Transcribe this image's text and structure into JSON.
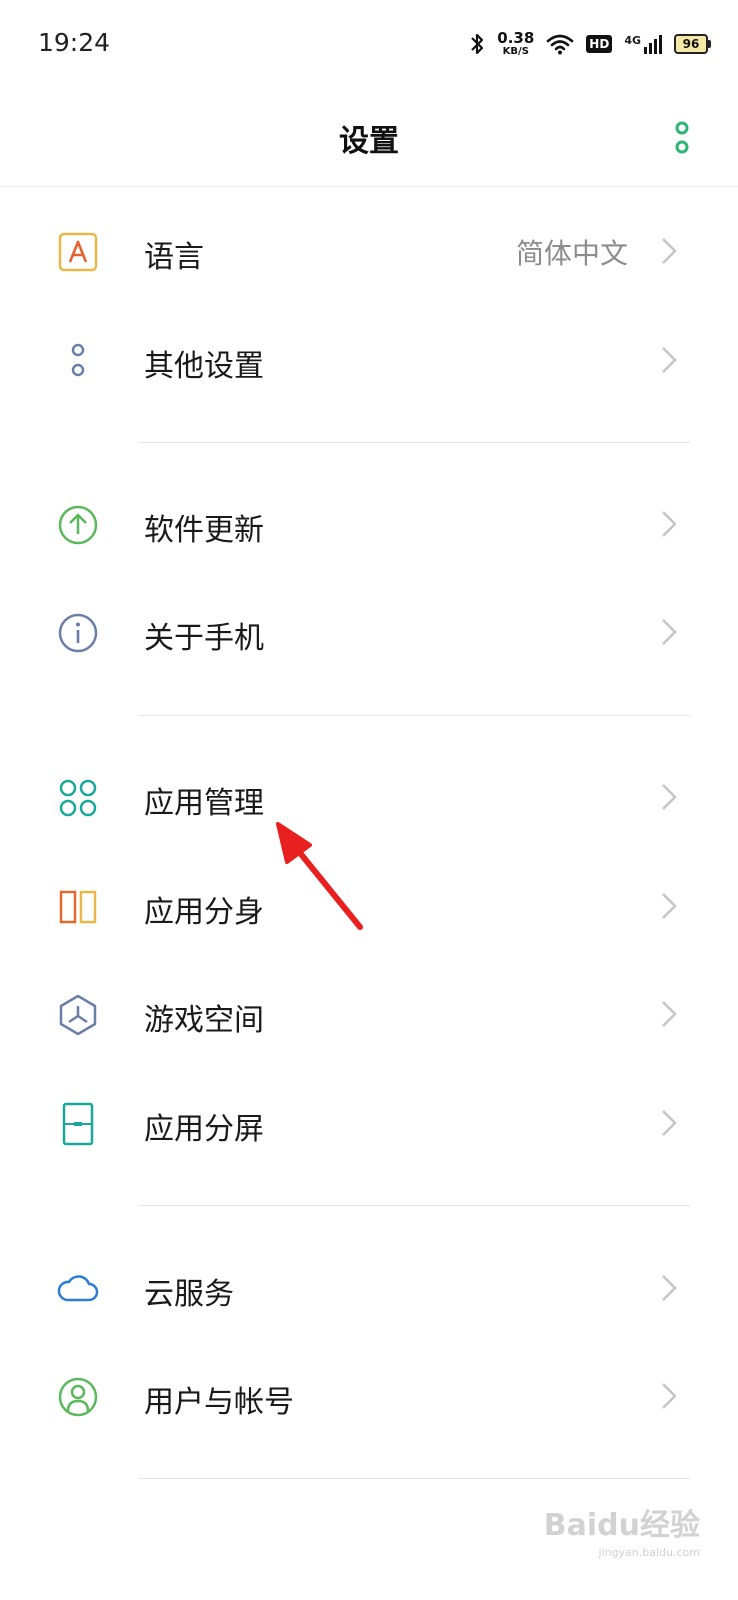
{
  "status_bar": {
    "time": "19:24",
    "net_speed": "0.38",
    "net_unit": "KB/S",
    "hd": "HD",
    "signal": "4G",
    "battery": "96"
  },
  "header": {
    "title": "设置"
  },
  "items": [
    {
      "label": "语言",
      "value": "简体中文",
      "icon": "language-icon"
    },
    {
      "label": "其他设置",
      "icon": "other-settings-icon"
    },
    {
      "label": "软件更新",
      "icon": "software-update-icon"
    },
    {
      "label": "关于手机",
      "icon": "about-phone-icon"
    },
    {
      "label": "应用管理",
      "icon": "app-management-icon"
    },
    {
      "label": "应用分身",
      "icon": "app-clone-icon"
    },
    {
      "label": "游戏空间",
      "icon": "game-space-icon"
    },
    {
      "label": "应用分屏",
      "icon": "split-screen-icon"
    },
    {
      "label": "云服务",
      "icon": "cloud-service-icon"
    },
    {
      "label": "用户与帐号",
      "icon": "user-account-icon"
    }
  ],
  "watermark": {
    "text": "Baidu经验",
    "sub": "jingyan.baidu.com"
  },
  "colors": {
    "accent": "#2bb673",
    "annotation": "#e8201f"
  }
}
